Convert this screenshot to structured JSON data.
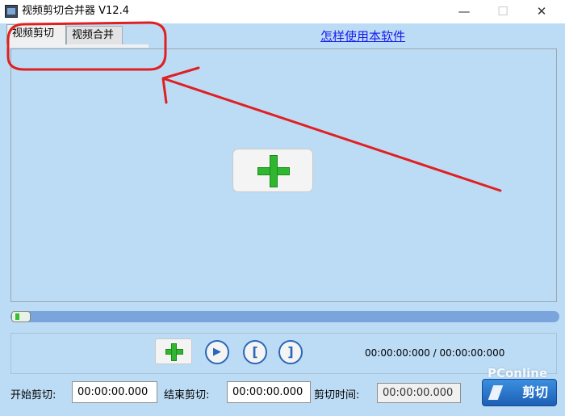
{
  "window": {
    "title": "视频剪切合并器 V12.4",
    "minimize_glyph": "—",
    "maximize_glyph": "☐",
    "close_glyph": "✕"
  },
  "tabs": [
    {
      "label": "视频剪切",
      "selected": true
    },
    {
      "label": "视频合并",
      "selected": false
    }
  ],
  "help_link": "怎样使用本软件",
  "progress": {
    "value": 0.02
  },
  "controls": {
    "play_glyph": "▶",
    "mark_start_glyph": "[",
    "mark_end_glyph": "]",
    "time_readout": "00:00:00:000 / 00:00:00:000"
  },
  "trim": {
    "start_label": "开始剪切:",
    "start_value": "00:00:00.000",
    "end_label": "结束剪切:",
    "end_value": "00:00:00.000",
    "duration_label": "剪切时间:",
    "duration_value": "00:00:00.000",
    "cut_button": "剪切"
  },
  "watermark": "PConline",
  "colors": {
    "background": "#bcdcf5",
    "accent": "#2b67b7",
    "plus_green": "#2fb82f",
    "annotation_red": "#e02020"
  }
}
